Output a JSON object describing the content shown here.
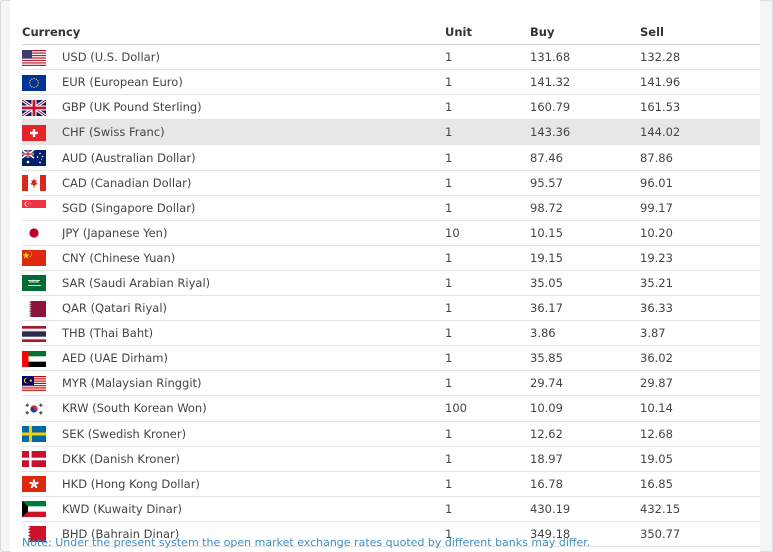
{
  "table": {
    "headers": {
      "currency": "Currency",
      "unit": "Unit",
      "buy": "Buy",
      "sell": "Sell"
    },
    "rows": [
      {
        "flag": "us-flag-icon",
        "name": "USD (U.S. Dollar)",
        "unit": "1",
        "buy": "131.68",
        "sell": "132.28"
      },
      {
        "flag": "eu-flag-icon",
        "name": "EUR (European Euro)",
        "unit": "1",
        "buy": "141.32",
        "sell": "141.96"
      },
      {
        "flag": "gb-flag-icon",
        "name": "GBP (UK Pound Sterling)",
        "unit": "1",
        "buy": "160.79",
        "sell": "161.53"
      },
      {
        "flag": "ch-flag-icon",
        "name": "CHF (Swiss Franc)",
        "unit": "1",
        "buy": "143.36",
        "sell": "144.02",
        "highlighted": true
      },
      {
        "flag": "au-flag-icon",
        "name": "AUD (Australian Dollar)",
        "unit": "1",
        "buy": "87.46",
        "sell": "87.86"
      },
      {
        "flag": "ca-flag-icon",
        "name": "CAD (Canadian Dollar)",
        "unit": "1",
        "buy": "95.57",
        "sell": "96.01"
      },
      {
        "flag": "sg-flag-icon",
        "name": "SGD (Singapore Dollar)",
        "unit": "1",
        "buy": "98.72",
        "sell": "99.17"
      },
      {
        "flag": "jp-flag-icon",
        "name": "JPY (Japanese Yen)",
        "unit": "10",
        "buy": "10.15",
        "sell": "10.20"
      },
      {
        "flag": "cn-flag-icon",
        "name": "CNY (Chinese Yuan)",
        "unit": "1",
        "buy": "19.15",
        "sell": "19.23"
      },
      {
        "flag": "sa-flag-icon",
        "name": "SAR (Saudi Arabian Riyal)",
        "unit": "1",
        "buy": "35.05",
        "sell": "35.21"
      },
      {
        "flag": "qa-flag-icon",
        "name": "QAR (Qatari Riyal)",
        "unit": "1",
        "buy": "36.17",
        "sell": "36.33"
      },
      {
        "flag": "th-flag-icon",
        "name": "THB (Thai Baht)",
        "unit": "1",
        "buy": "3.86",
        "sell": "3.87"
      },
      {
        "flag": "ae-flag-icon",
        "name": "AED (UAE Dirham)",
        "unit": "1",
        "buy": "35.85",
        "sell": "36.02"
      },
      {
        "flag": "my-flag-icon",
        "name": "MYR (Malaysian Ringgit)",
        "unit": "1",
        "buy": "29.74",
        "sell": "29.87"
      },
      {
        "flag": "kr-flag-icon",
        "name": "KRW (South Korean Won)",
        "unit": "100",
        "buy": "10.09",
        "sell": "10.14"
      },
      {
        "flag": "se-flag-icon",
        "name": "SEK (Swedish Kroner)",
        "unit": "1",
        "buy": "12.62",
        "sell": "12.68"
      },
      {
        "flag": "dk-flag-icon",
        "name": "DKK (Danish Kroner)",
        "unit": "1",
        "buy": "18.97",
        "sell": "19.05"
      },
      {
        "flag": "hk-flag-icon",
        "name": "HKD (Hong Kong Dollar)",
        "unit": "1",
        "buy": "16.78",
        "sell": "16.85"
      },
      {
        "flag": "kw-flag-icon",
        "name": "KWD (Kuwaity Dinar)",
        "unit": "1",
        "buy": "430.19",
        "sell": "432.15"
      },
      {
        "flag": "bh-flag-icon",
        "name": "BHD (Bahrain Dinar)",
        "unit": "1",
        "buy": "349.18",
        "sell": "350.77"
      }
    ]
  },
  "note": "Note: Under the present system the open market exchange rates quoted by different banks may differ.",
  "colors": {
    "note_text": "#3d8ec2",
    "row_highlight": "#e7e7e7",
    "row_border": "#e4e4e4"
  }
}
